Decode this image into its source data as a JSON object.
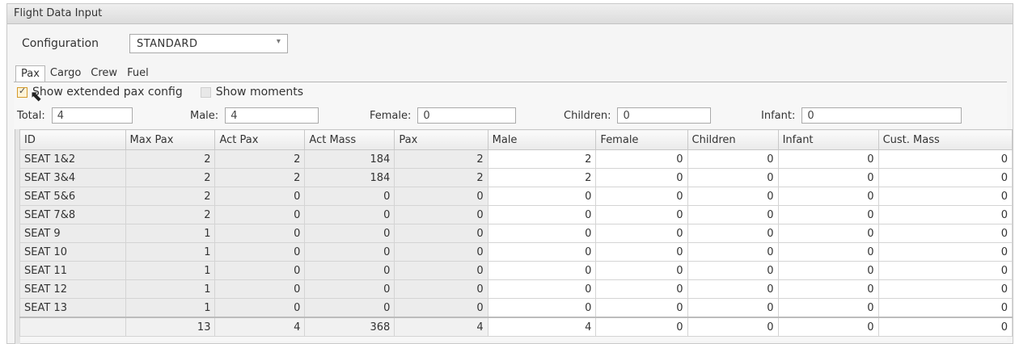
{
  "window": {
    "title": "Flight Data Input"
  },
  "configuration": {
    "label": "Configuration",
    "value": "STANDARD",
    "arrow": "▾"
  },
  "tabs": [
    {
      "label": "Pax",
      "active": true
    },
    {
      "label": "Cargo",
      "active": false
    },
    {
      "label": "Crew",
      "active": false
    },
    {
      "label": "Fuel",
      "active": false
    }
  ],
  "options": {
    "extended": {
      "label": "Show extended pax config",
      "checked": true
    },
    "moments": {
      "label": "Show moments",
      "checked": false
    }
  },
  "totals": {
    "total": {
      "label": "Total:",
      "value": "4"
    },
    "male": {
      "label": "Male:",
      "value": "4"
    },
    "female": {
      "label": "Female:",
      "value": "0"
    },
    "children": {
      "label": "Children:",
      "value": "0"
    },
    "infant": {
      "label": "Infant:",
      "value": "0"
    }
  },
  "grid": {
    "headers": [
      "ID",
      "Max Pax",
      "Act Pax",
      "Act Mass",
      "Pax",
      "Male",
      "Female",
      "Children",
      "Infant",
      "Cust. Mass"
    ],
    "rows": [
      [
        "SEAT 1&2",
        "2",
        "2",
        "184",
        "2",
        "2",
        "0",
        "0",
        "0",
        "0"
      ],
      [
        "SEAT 3&4",
        "2",
        "2",
        "184",
        "2",
        "2",
        "0",
        "0",
        "0",
        "0"
      ],
      [
        "SEAT 5&6",
        "2",
        "0",
        "0",
        "0",
        "0",
        "0",
        "0",
        "0",
        "0"
      ],
      [
        "SEAT 7&8",
        "2",
        "0",
        "0",
        "0",
        "0",
        "0",
        "0",
        "0",
        "0"
      ],
      [
        "SEAT 9",
        "1",
        "0",
        "0",
        "0",
        "0",
        "0",
        "0",
        "0",
        "0"
      ],
      [
        "SEAT 10",
        "1",
        "0",
        "0",
        "0",
        "0",
        "0",
        "0",
        "0",
        "0"
      ],
      [
        "SEAT 11",
        "1",
        "0",
        "0",
        "0",
        "0",
        "0",
        "0",
        "0",
        "0"
      ],
      [
        "SEAT 12",
        "1",
        "0",
        "0",
        "0",
        "0",
        "0",
        "0",
        "0",
        "0"
      ],
      [
        "SEAT 13",
        "1",
        "0",
        "0",
        "0",
        "0",
        "0",
        "0",
        "0",
        "0"
      ]
    ],
    "total_row": [
      "",
      "13",
      "4",
      "368",
      "4",
      "4",
      "0",
      "0",
      "0",
      "0"
    ]
  }
}
